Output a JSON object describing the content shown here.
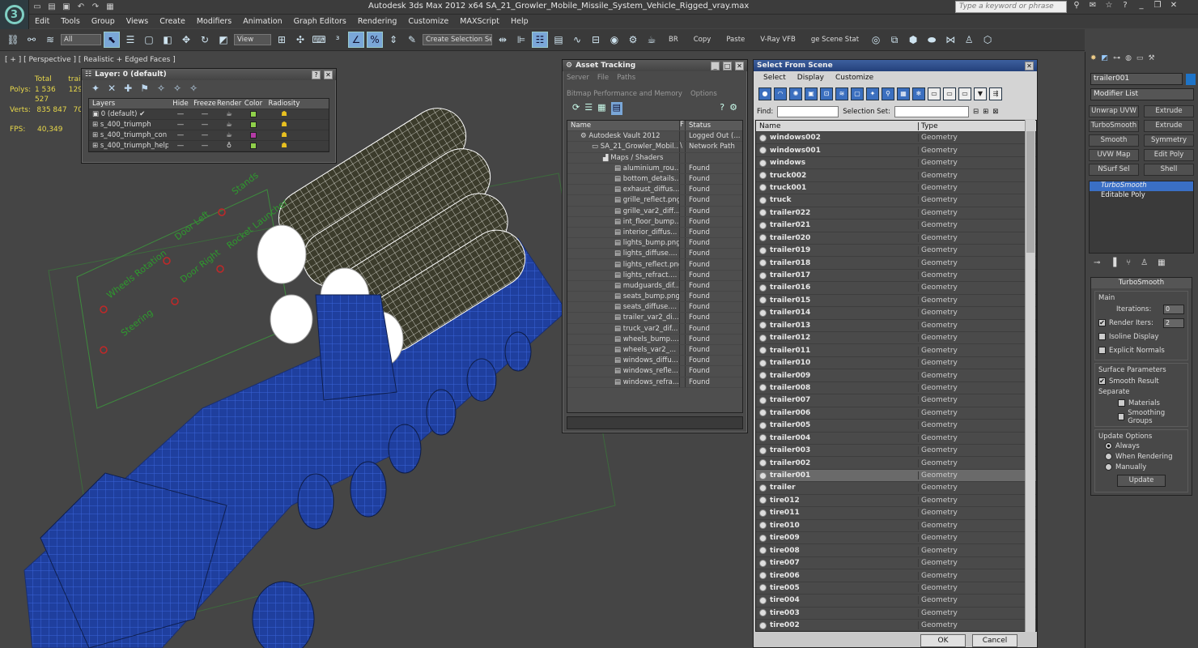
{
  "app": {
    "title": "Autodesk 3ds Max  2012 x64     SA_21_Growler_Mobile_Missile_System_Vehicle_Rigged_vray.max",
    "help_search_placeholder": "Type a keyword or phrase"
  },
  "menu": [
    "Edit",
    "Tools",
    "Group",
    "Views",
    "Create",
    "Modifiers",
    "Animation",
    "Graph Editors",
    "Rendering",
    "Customize",
    "MAXScript",
    "Help"
  ],
  "toolbar": {
    "filter": "All",
    "ref_coord": "View",
    "selection_set": "Create Selection Se",
    "br": "BR",
    "copy": "Copy",
    "paste": "Paste",
    "vray_vfb": "V-Ray VFB",
    "scene_state": "ge Scene Stat"
  },
  "viewport": {
    "label": "[ + ] [ Perspective ] [ Realistic + Edged Faces ]",
    "stats": {
      "total_label": "Total",
      "obj_label": "trail",
      "polys_label": "Polys:",
      "polys_value": "1 536 527",
      "polys_obj": "129",
      "verts_label": "Verts:",
      "verts_value": "835 847",
      "verts_obj": "70",
      "fps_label": "FPS:",
      "fps_value": "40,349"
    },
    "rig_labels": [
      "Wheels Rotation",
      "Door Left",
      "Door Right",
      "Steering",
      "Rocket Launcher",
      "Stands"
    ]
  },
  "layer_window": {
    "title": "Layer: 0 (default)",
    "headers": [
      "Layers",
      "Hide",
      "Freeze",
      "Render",
      "Color",
      "Radiosity"
    ],
    "rows": [
      {
        "name": "0 (default)",
        "color": "#8fd04a"
      },
      {
        "name": "s_400_triumph",
        "color": "#8fd04a"
      },
      {
        "name": "s_400_triumph_con",
        "color": "#b43aa6"
      },
      {
        "name": "s_400_triumph_help",
        "color": "#8fd04a"
      }
    ]
  },
  "asset_window": {
    "title": "Asset Tracking",
    "menu": [
      "Server",
      "File",
      "Paths",
      "Bitmap Performance and Memory",
      "Options"
    ],
    "headers": [
      "Name",
      "F",
      "Status"
    ],
    "rows": [
      {
        "name": "Autodesk Vault 2012",
        "status": "Logged Out (..."
      },
      {
        "name": "SA_21_Growler_Mobil...",
        "f": "\\",
        "status": "Network Path"
      },
      {
        "name": "Maps / Shaders",
        "status": ""
      },
      {
        "name": "aluminium_rou...",
        "status": "Found"
      },
      {
        "name": "bottom_details...",
        "status": "Found"
      },
      {
        "name": "exhaust_diffus...",
        "status": "Found"
      },
      {
        "name": "grille_reflect.png",
        "status": "Found"
      },
      {
        "name": "grille_var2_diff...",
        "status": "Found"
      },
      {
        "name": "int_floor_bump...",
        "status": "Found"
      },
      {
        "name": "interior_diffus...",
        "status": "Found"
      },
      {
        "name": "lights_bump.png",
        "status": "Found"
      },
      {
        "name": "lights_diffuse....",
        "status": "Found"
      },
      {
        "name": "lights_reflect.png",
        "status": "Found"
      },
      {
        "name": "lights_refract....",
        "status": "Found"
      },
      {
        "name": "mudguards_dif...",
        "status": "Found"
      },
      {
        "name": "seats_bump.png",
        "status": "Found"
      },
      {
        "name": "seats_diffuse....",
        "status": "Found"
      },
      {
        "name": "trailer_var2_di...",
        "status": "Found"
      },
      {
        "name": "truck_var2_dif...",
        "status": "Found"
      },
      {
        "name": "wheels_bump....",
        "status": "Found"
      },
      {
        "name": "wheels_var2_...",
        "status": "Found"
      },
      {
        "name": "windows_diffu...",
        "status": "Found"
      },
      {
        "name": "windows_refle...",
        "status": "Found"
      },
      {
        "name": "windows_refra...",
        "status": "Found"
      }
    ]
  },
  "select_window": {
    "title": "Select From Scene",
    "menu": [
      "Select",
      "Display",
      "Customize"
    ],
    "find_label": "Find:",
    "selset_label": "Selection Set:",
    "headers": [
      "Name",
      "Type"
    ],
    "rows": [
      {
        "name": "windows002",
        "type": "Geometry"
      },
      {
        "name": "windows001",
        "type": "Geometry"
      },
      {
        "name": "windows",
        "type": "Geometry"
      },
      {
        "name": "truck002",
        "type": "Geometry"
      },
      {
        "name": "truck001",
        "type": "Geometry"
      },
      {
        "name": "truck",
        "type": "Geometry"
      },
      {
        "name": "trailer022",
        "type": "Geometry"
      },
      {
        "name": "trailer021",
        "type": "Geometry"
      },
      {
        "name": "trailer020",
        "type": "Geometry"
      },
      {
        "name": "trailer019",
        "type": "Geometry"
      },
      {
        "name": "trailer018",
        "type": "Geometry"
      },
      {
        "name": "trailer017",
        "type": "Geometry"
      },
      {
        "name": "trailer016",
        "type": "Geometry"
      },
      {
        "name": "trailer015",
        "type": "Geometry"
      },
      {
        "name": "trailer014",
        "type": "Geometry"
      },
      {
        "name": "trailer013",
        "type": "Geometry"
      },
      {
        "name": "trailer012",
        "type": "Geometry"
      },
      {
        "name": "trailer011",
        "type": "Geometry"
      },
      {
        "name": "trailer010",
        "type": "Geometry"
      },
      {
        "name": "trailer009",
        "type": "Geometry"
      },
      {
        "name": "trailer008",
        "type": "Geometry"
      },
      {
        "name": "trailer007",
        "type": "Geometry"
      },
      {
        "name": "trailer006",
        "type": "Geometry"
      },
      {
        "name": "trailer005",
        "type": "Geometry"
      },
      {
        "name": "trailer004",
        "type": "Geometry"
      },
      {
        "name": "trailer003",
        "type": "Geometry"
      },
      {
        "name": "trailer002",
        "type": "Geometry"
      },
      {
        "name": "trailer001",
        "type": "Geometry",
        "selected": true
      },
      {
        "name": "trailer",
        "type": "Geometry"
      },
      {
        "name": "tire012",
        "type": "Geometry"
      },
      {
        "name": "tire011",
        "type": "Geometry"
      },
      {
        "name": "tire010",
        "type": "Geometry"
      },
      {
        "name": "tire009",
        "type": "Geometry"
      },
      {
        "name": "tire008",
        "type": "Geometry"
      },
      {
        "name": "tire007",
        "type": "Geometry"
      },
      {
        "name": "tire006",
        "type": "Geometry"
      },
      {
        "name": "tire005",
        "type": "Geometry"
      },
      {
        "name": "tire004",
        "type": "Geometry"
      },
      {
        "name": "tire003",
        "type": "Geometry"
      },
      {
        "name": "tire002",
        "type": "Geometry"
      }
    ],
    "ok": "OK",
    "cancel": "Cancel"
  },
  "command_panel": {
    "object_name": "trailer001",
    "object_color": "#1e74c8",
    "modifier_list": "Modifier List",
    "mod_buttons": [
      "Unwrap UVW",
      "Extrude",
      "TurboSmooth",
      "Extrude",
      "Smooth",
      "Symmetry",
      "UVW Map",
      "Edit Poly",
      "NSurf Sel",
      "Shell"
    ],
    "stack": [
      "TurboSmooth",
      "Editable Poly"
    ],
    "turbosmooth": {
      "header": "TurboSmooth",
      "main": "Main",
      "iterations_label": "Iterations:",
      "iterations_value": "0",
      "render_iters_label": "Render Iters:",
      "render_iters_value": "2",
      "isoline": "Isoline Display",
      "explicit": "Explicit Normals",
      "surface": "Surface Parameters",
      "smooth_result": "Smooth Result",
      "separate": "Separate",
      "materials": "Materials",
      "smoothing_groups": "Smoothing Groups",
      "update_options": "Update Options",
      "always": "Always",
      "when_rendering": "When Rendering",
      "manually": "Manually",
      "update": "Update"
    }
  }
}
